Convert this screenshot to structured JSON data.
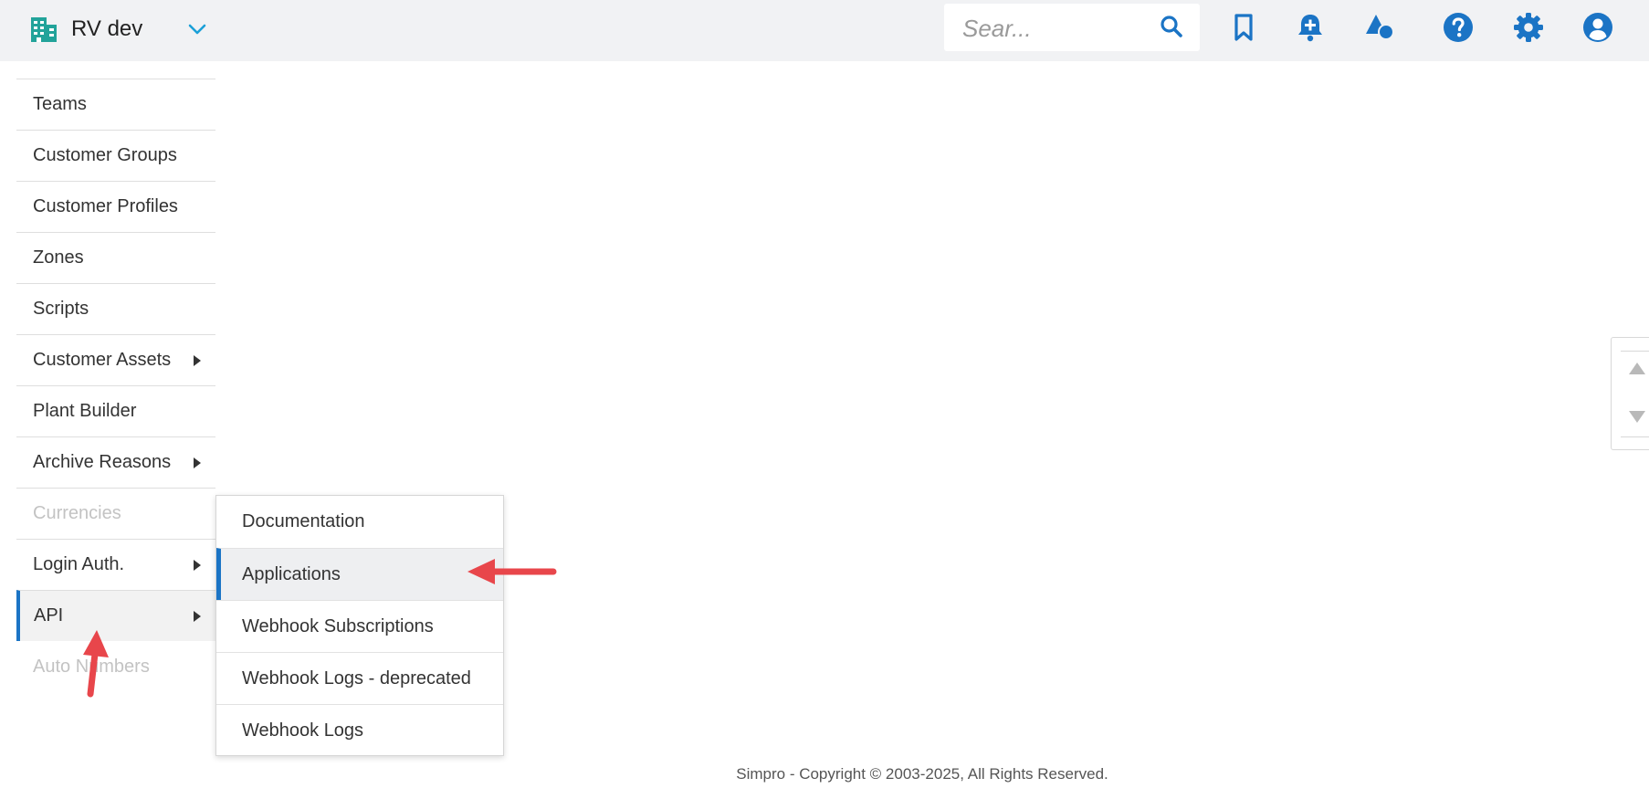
{
  "header": {
    "company_name": "RV dev",
    "company_icon": "building-icon",
    "dropdown_icon": "chevron-down-icon",
    "search_placeholder": "Sear...",
    "icons": [
      "search-icon",
      "bookmark-icon",
      "add-notification-icon",
      "shapes-icon",
      "help-icon",
      "gear-icon",
      "user-icon"
    ]
  },
  "sidebar": {
    "items": [
      {
        "label": "Teams"
      },
      {
        "label": "Customer Groups"
      },
      {
        "label": "Customer Profiles"
      },
      {
        "label": "Zones"
      },
      {
        "label": "Scripts"
      },
      {
        "label": "Customer Assets",
        "submenu": true
      },
      {
        "label": "Plant Builder"
      },
      {
        "label": "Archive Reasons",
        "submenu": true
      },
      {
        "label": "Currencies",
        "disabled": true
      },
      {
        "label": "Login Auth.",
        "submenu": true
      },
      {
        "label": "API",
        "submenu": true,
        "active": true
      },
      {
        "label": "Auto Numbers",
        "disabled": true
      }
    ]
  },
  "submenu": {
    "items": [
      {
        "label": "Documentation"
      },
      {
        "label": "Applications",
        "highlighted": true
      },
      {
        "label": "Webhook Subscriptions"
      },
      {
        "label": "Webhook Logs - deprecated"
      },
      {
        "label": "Webhook Logs"
      }
    ]
  },
  "footer": {
    "text": "Simpro - Copyright © 2003-2025, All Rights Reserved."
  },
  "colors": {
    "accent": "#1b74c5",
    "header_bg": "#f1f2f4",
    "teal_icon": "#22a39a",
    "annotation_arrow": "#e8464b"
  }
}
